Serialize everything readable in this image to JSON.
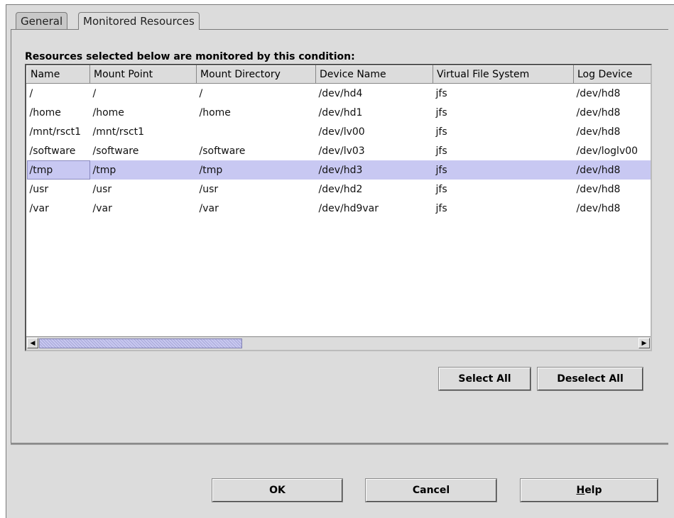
{
  "tabs": [
    {
      "label": "General",
      "active": false
    },
    {
      "label": "Monitored Resources",
      "active": true
    }
  ],
  "caption": "Resources selected below are monitored by this condition:",
  "table": {
    "columns": [
      "Name",
      "Mount Point",
      "Mount Directory",
      "Device Name",
      "Virtual File System",
      "Log Device"
    ],
    "rows": [
      [
        "/",
        "/",
        "/",
        "/dev/hd4",
        "jfs",
        "/dev/hd8"
      ],
      [
        "/home",
        "/home",
        "/home",
        "/dev/hd1",
        "jfs",
        "/dev/hd8"
      ],
      [
        "/mnt/rsct1",
        "/mnt/rsct1",
        "",
        "/dev/lv00",
        "jfs",
        "/dev/hd8"
      ],
      [
        "/software",
        "/software",
        "/software",
        "/dev/lv03",
        "jfs",
        "/dev/loglv00"
      ],
      [
        "/tmp",
        "/tmp",
        "/tmp",
        "/dev/hd3",
        "jfs",
        "/dev/hd8"
      ],
      [
        "/usr",
        "/usr",
        "/usr",
        "/dev/hd2",
        "jfs",
        "/dev/hd8"
      ],
      [
        "/var",
        "/var",
        "/var",
        "/dev/hd9var",
        "jfs",
        "/dev/hd8"
      ]
    ],
    "selected_row": 4
  },
  "buttons": {
    "select_all": "Select All",
    "deselect_all": "Deselect All",
    "ok": "OK",
    "cancel": "Cancel",
    "help_hotkey": "H",
    "help_rest": "elp"
  },
  "icons": {
    "scroll_left": "◀",
    "scroll_right": "▶"
  },
  "colors": {
    "selection": "#c8c8f2",
    "background": "#dcdcdc"
  }
}
